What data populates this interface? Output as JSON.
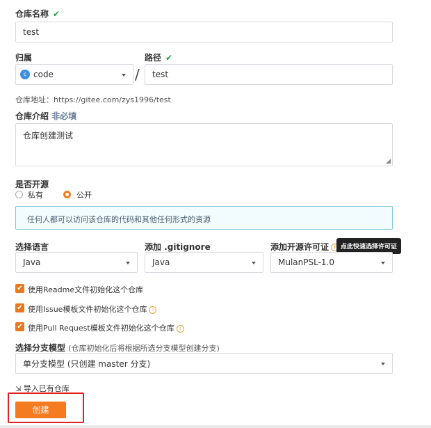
{
  "repo_name": {
    "label": "仓库名称",
    "value": "test"
  },
  "owner": {
    "label": "归属",
    "avatar_letter": "c",
    "value": "code"
  },
  "separator": "/",
  "path": {
    "label": "路径",
    "value": "test"
  },
  "repo_address": "仓库地址：https://gitee.com/zys1996/test",
  "description": {
    "label": "仓库介绍",
    "optional": "非必填",
    "value": "仓库创建测试"
  },
  "open_source": {
    "label": "是否开源",
    "private": "私有",
    "public": "公开",
    "selected": "public",
    "info": "任何人都可以访问该仓库的代码和其他任何形式的资源"
  },
  "language": {
    "label": "选择语言",
    "value": "Java"
  },
  "gitignore": {
    "label": "添加 .gitignore",
    "value": "Java"
  },
  "license": {
    "label": "添加开源许可证",
    "value": "MulanPSL-1.0",
    "tooltip": "点此快速选择许可证"
  },
  "checkboxes": [
    {
      "label": "使用Readme文件初始化这个仓库",
      "checked": true
    },
    {
      "label": "使用Issue模板文件初始化这个仓库",
      "checked": true
    },
    {
      "label": "使用Pull Request模板文件初始化这个仓库",
      "checked": true
    }
  ],
  "branch_model": {
    "label": "选择分支模型",
    "hint": "(仓库初始化后将根据所选分支模型创建分支)",
    "value": "单分支模型 (只创建 master 分支)"
  },
  "import_link": "导入已有仓库",
  "create_button": "创建",
  "colors": {
    "accent": "#f47b20",
    "success": "#21a142",
    "highlight_border": "#e02020",
    "info_bg": "#f2fbfd",
    "info_border": "#7fc9d9"
  }
}
